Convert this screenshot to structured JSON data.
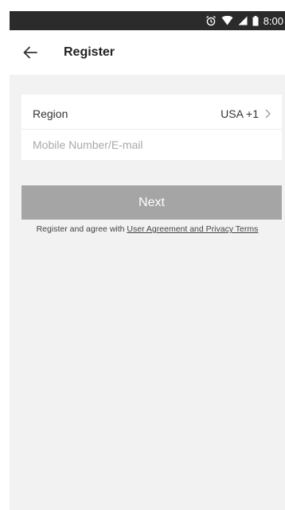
{
  "status_bar": {
    "time": "8:00",
    "icons": [
      "alarm-icon",
      "wifi-icon",
      "signal-icon",
      "battery-icon"
    ]
  },
  "header": {
    "title": "Register",
    "back_icon": "arrow-left-icon"
  },
  "form": {
    "region_label": "Region",
    "region_value": "USA +1",
    "region_chevron": "chevron-right-icon",
    "account_placeholder": "Mobile Number/E-mail",
    "account_value": ""
  },
  "actions": {
    "next_label": "Next"
  },
  "terms": {
    "prefix": "Register and agree with ",
    "link_label": "User Agreement and Privacy Terms"
  },
  "colors": {
    "status_bar_bg": "#2b2b2b",
    "page_bg": "#f2f2f2",
    "button_disabled": "#a5a5a5"
  }
}
